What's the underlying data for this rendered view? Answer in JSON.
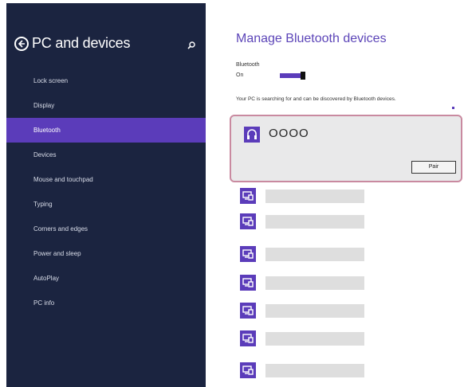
{
  "sidebar": {
    "title": "PC and devices",
    "items": [
      {
        "label": "Lock screen",
        "selected": false
      },
      {
        "label": "Display",
        "selected": false
      },
      {
        "label": "Bluetooth",
        "selected": true
      },
      {
        "label": "Devices",
        "selected": false
      },
      {
        "label": "Mouse and touchpad",
        "selected": false
      },
      {
        "label": "Typing",
        "selected": false
      },
      {
        "label": "Corners and edges",
        "selected": false
      },
      {
        "label": "Power and sleep",
        "selected": false
      },
      {
        "label": "AutoPlay",
        "selected": false
      },
      {
        "label": "PC info",
        "selected": false
      }
    ]
  },
  "main": {
    "title": "Manage Bluetooth devices",
    "bluetooth_label": "Bluetooth",
    "bluetooth_state": "On",
    "status_text": "Your PC is searching for and can be discovered by Bluetooth devices.",
    "selected_device": {
      "name": "OOOO",
      "icon": "headphones-icon",
      "pair_label": "Pair"
    },
    "device_list_count_icon": "device-icon"
  },
  "colors": {
    "sidebar_bg": "#1b2440",
    "accent": "#5b3cba",
    "card_border": "#c98aa0"
  }
}
